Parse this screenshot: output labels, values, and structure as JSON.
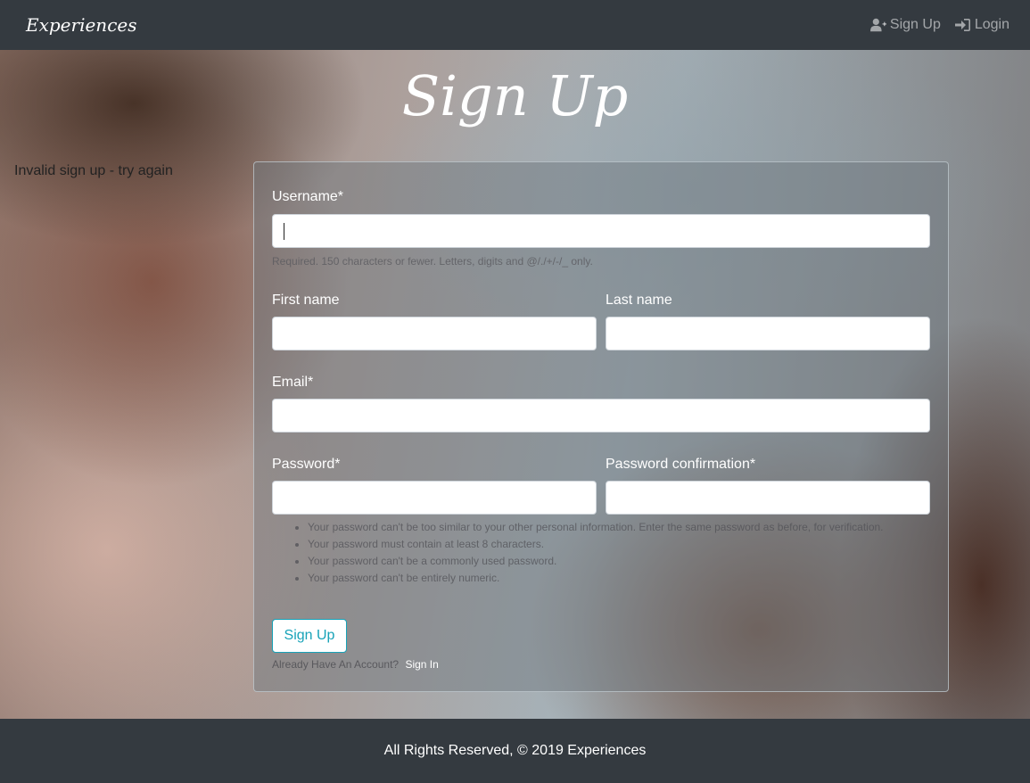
{
  "nav": {
    "brand": "Experiences",
    "signup_label": "Sign Up",
    "login_label": "Login"
  },
  "page": {
    "title": "Sign Up",
    "error": "Invalid sign up - try again"
  },
  "form": {
    "username_label": "Username*",
    "username_value": "",
    "username_help": "Required. 150 characters or fewer. Letters, digits and @/./+/-/_ only.",
    "first_name_label": "First name",
    "first_name_value": "",
    "last_name_label": "Last name",
    "last_name_value": "",
    "email_label": "Email*",
    "email_value": "",
    "password_label": "Password*",
    "password_value": "",
    "password_confirm_label": "Password confirmation*",
    "password_confirm_value": "",
    "password_rules": [
      "Your password can't be too similar to your other personal information. Enter the same password as before, for verification.",
      "Your password must contain at least 8 characters.",
      "Your password can't be a commonly used password.",
      "Your password can't be entirely numeric."
    ],
    "submit_label": "Sign Up",
    "have_account_text": "Already Have An Account?",
    "signin_link": "Sign In"
  },
  "footer": {
    "text": "All Rights Reserved, © 2019 Experiences"
  },
  "colors": {
    "navbar": "#343a40",
    "accent": "#17a2b8"
  }
}
